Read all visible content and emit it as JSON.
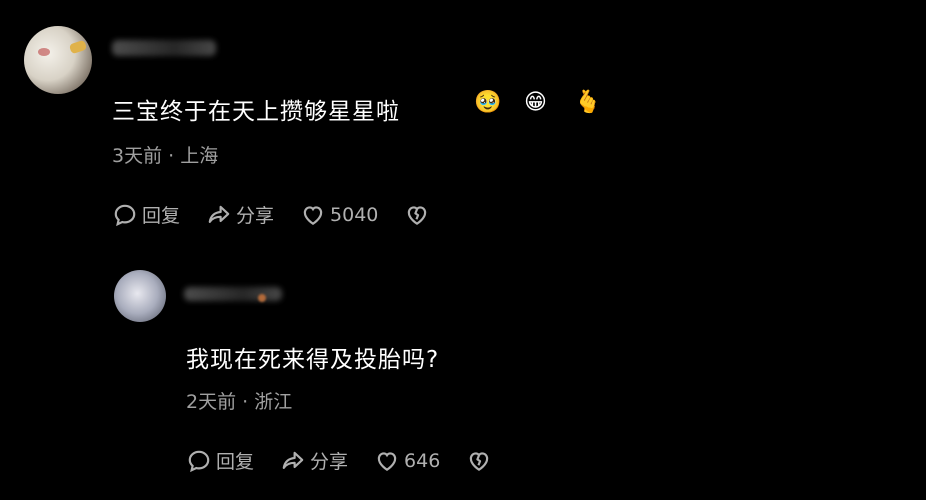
{
  "comments": [
    {
      "text": "三宝终于在天上攒够星星啦",
      "emojis": [
        "🥹",
        "😁",
        "🫰"
      ],
      "time": "3天前",
      "separator": "·",
      "location": "上海",
      "reply_label": "回复",
      "share_label": "分享",
      "likes": "5040"
    },
    {
      "text": "我现在死来得及投胎吗?",
      "time": "2天前",
      "separator": "·",
      "location": "浙江",
      "reply_label": "回复",
      "share_label": "分享",
      "likes": "646"
    }
  ],
  "icons": {
    "reply": "speech-bubble-icon",
    "share": "share-arrow-icon",
    "like": "heart-icon",
    "dislike": "broken-heart-icon"
  }
}
